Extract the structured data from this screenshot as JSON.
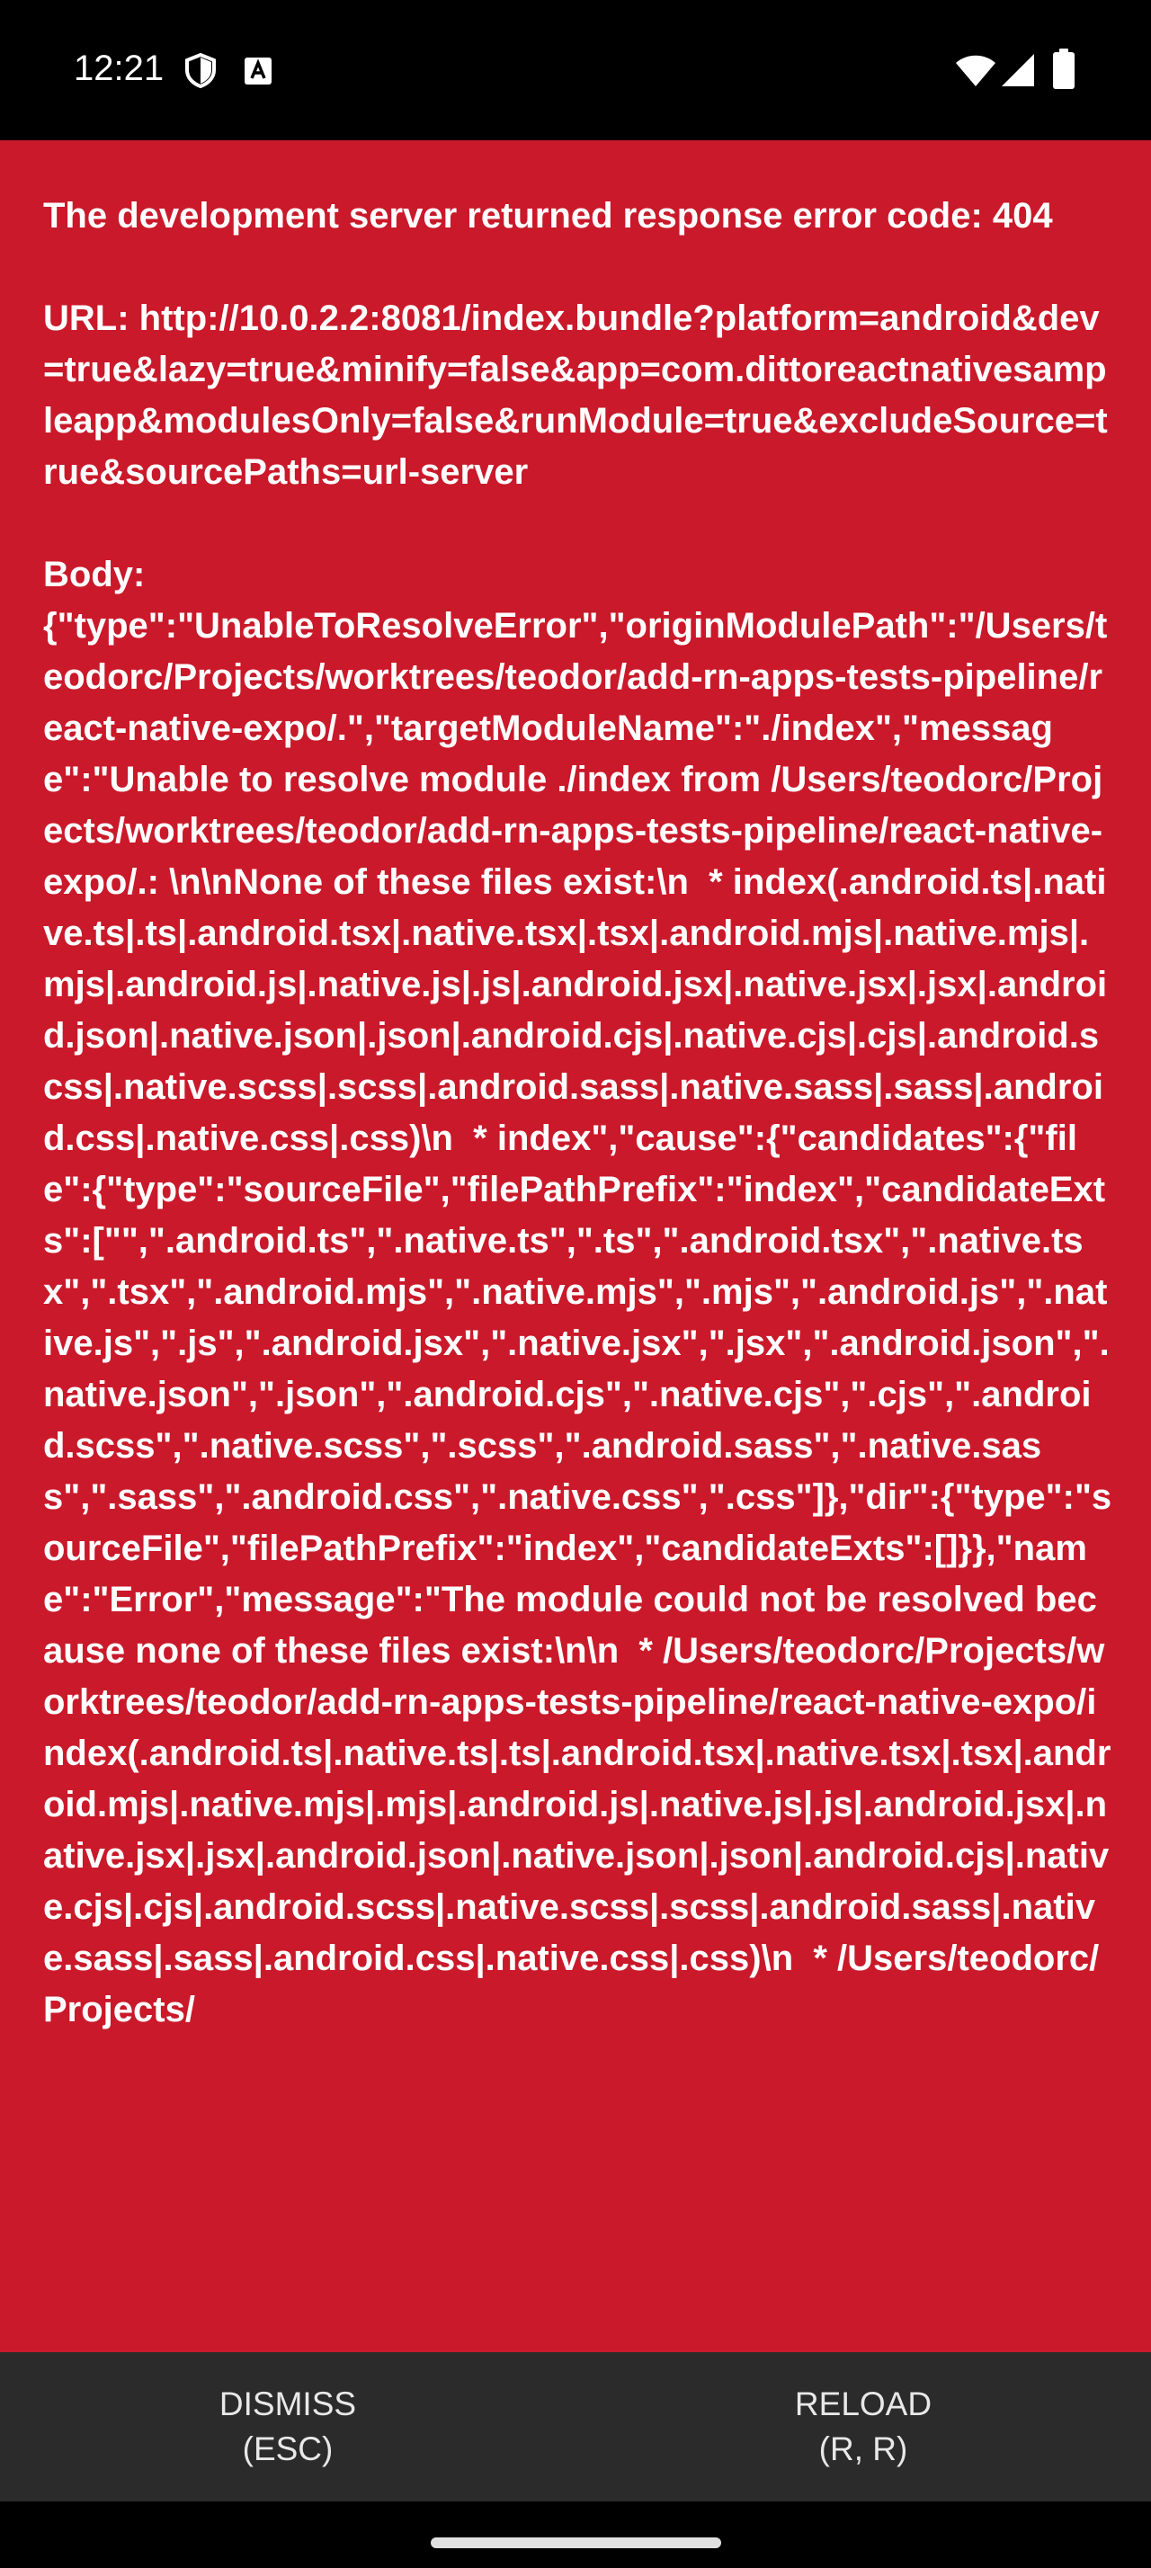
{
  "status_bar": {
    "time": "12:21",
    "icons": [
      "shield-icon",
      "keyboard-a-icon",
      "wifi-icon",
      "cellular-signal-icon",
      "battery-icon"
    ]
  },
  "error": {
    "background_color": "#c9192a",
    "message": "The development server returned response error code: 404\n\nURL: http://10.0.2.2:8081/index.bundle?platform=android&dev=true&lazy=true&minify=false&app=com.dittoreactnativesampleapp&modulesOnly=false&runModule=true&excludeSource=true&sourcePaths=url-server\n\nBody:\n{\"type\":\"UnableToResolveError\",\"originModulePath\":\"/Users/teodorc/Projects/worktrees/teodor/add-rn-apps-tests-pipeline/react-native-expo/.\",\"targetModuleName\":\"./index\",\"message\":\"Unable to resolve module ./index from /Users/teodorc/Projects/worktrees/teodor/add-rn-apps-tests-pipeline/react-native-expo/.: \\n\\nNone of these files exist:\\n  * index(.android.ts|.native.ts|.ts|.android.tsx|.native.tsx|.tsx|.android.mjs|.native.mjs|.mjs|.android.js|.native.js|.js|.android.jsx|.native.jsx|.jsx|.android.json|.native.json|.json|.android.cjs|.native.cjs|.cjs|.android.scss|.native.scss|.scss|.android.sass|.native.sass|.sass|.android.css|.native.css|.css)\\n  * index\",\"cause\":{\"candidates\":{\"file\":{\"type\":\"sourceFile\",\"filePathPrefix\":\"index\",\"candidateExts\":[\"\",\".android.ts\",\".native.ts\",\".ts\",\".android.tsx\",\".native.tsx\",\".tsx\",\".android.mjs\",\".native.mjs\",\".mjs\",\".android.js\",\".native.js\",\".js\",\".android.jsx\",\".native.jsx\",\".jsx\",\".android.json\",\".native.json\",\".json\",\".android.cjs\",\".native.cjs\",\".cjs\",\".android.scss\",\".native.scss\",\".scss\",\".android.sass\",\".native.sass\",\".sass\",\".android.css\",\".native.css\",\".css\"]},\"dir\":{\"type\":\"sourceFile\",\"filePathPrefix\":\"index\",\"candidateExts\":[]}},\"name\":\"Error\",\"message\":\"The module could not be resolved because none of these files exist:\\n\\n  * /Users/teodorc/Projects/worktrees/teodor/add-rn-apps-tests-pipeline/react-native-expo/index(.android.ts|.native.ts|.ts|.android.tsx|.native.tsx|.tsx|.android.mjs|.native.mjs|.mjs|.android.js|.native.js|.js|.android.jsx|.native.jsx|.jsx|.android.json|.native.json|.json|.android.cjs|.native.cjs|.cjs|.android.scss|.native.scss|.scss|.android.sass|.native.sass|.sass|.android.css|.native.css|.css)\\n  * /Users/teodorc/Projects/"
  },
  "footer": {
    "dismiss_label": "DISMISS\n(ESC)",
    "reload_label": "RELOAD\n(R, R)"
  }
}
